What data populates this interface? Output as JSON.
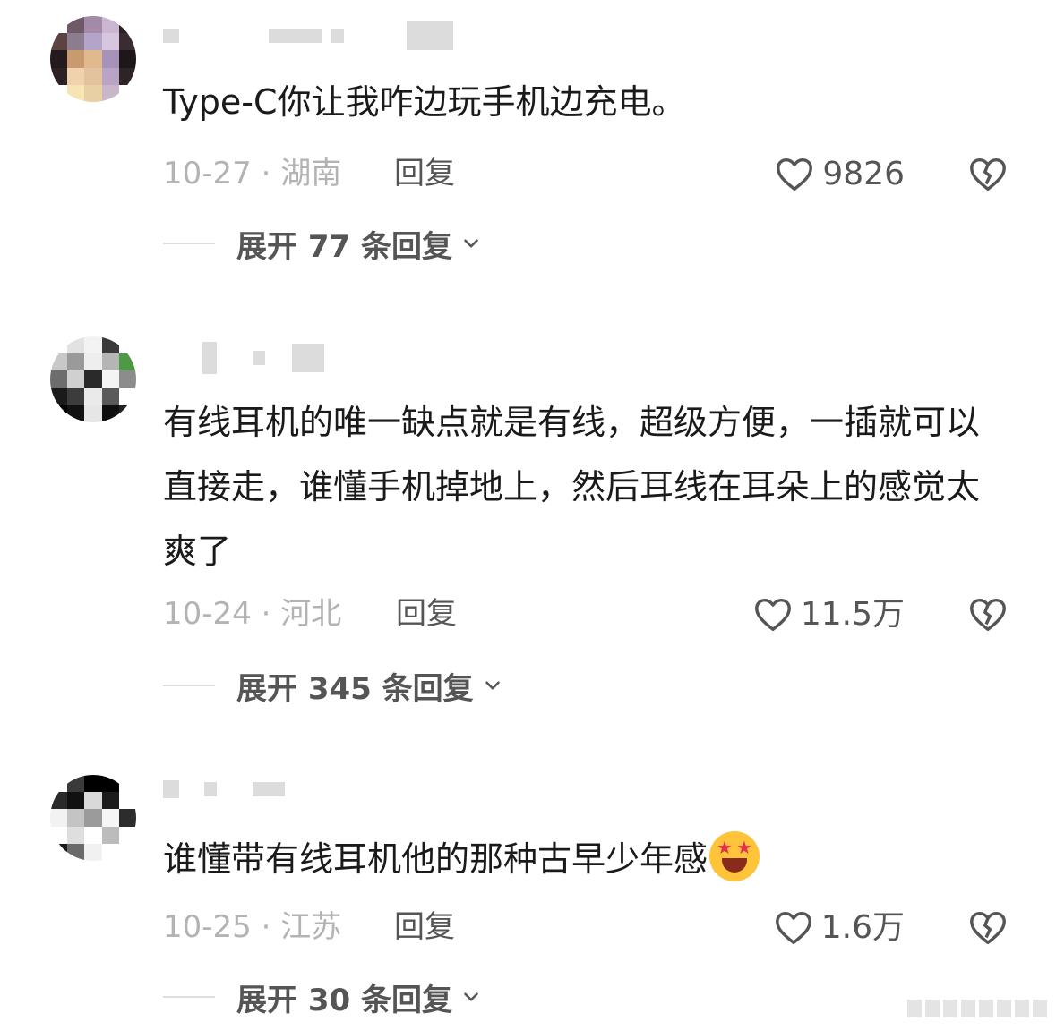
{
  "comments": [
    {
      "text": "Type-C你让我咋边玩手机边充电。",
      "date_location": "10-27 · 湖南",
      "reply_label": "回复",
      "like_count": "9826",
      "expand_label": "展开 77 条回复"
    },
    {
      "text": "有线耳机的唯一缺点就是有线，超级方便，一插就可以直接走，谁懂手机掉地上，然后耳线在耳朵上的感觉太爽了",
      "date_location": "10-24 · 河北",
      "reply_label": "回复",
      "like_count": "11.5万",
      "expand_label": "展开 345 条回复"
    },
    {
      "text": "谁懂带有线耳机他的那种古早少年感",
      "emoji": "star-struck-face",
      "date_location": "10-25 · 江苏",
      "reply_label": "回复",
      "like_count": "1.6万",
      "expand_label": "展开 30 条回复"
    }
  ],
  "icons": {
    "like": "heart-outline-icon",
    "dislike": "broken-heart-icon",
    "expand": "chevron-down-icon"
  },
  "colors": {
    "text": "#1a1a1a",
    "meta": "#b3b3b3",
    "action": "#555555"
  }
}
